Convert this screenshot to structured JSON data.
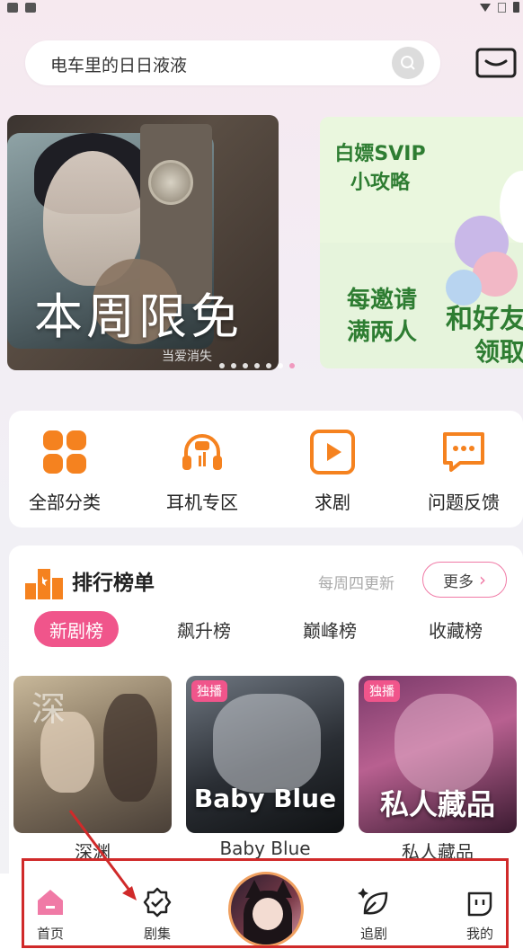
{
  "search": {
    "query": "电车里的日日液液"
  },
  "banners": [
    {
      "title": "本周限免",
      "subtitle": "当爱消失"
    },
    {
      "lines": [
        "白嫖SVIP",
        "小攻略"
      ],
      "lines2": [
        "每邀请",
        "满两人"
      ],
      "side1": "和好友",
      "side2": "领取"
    }
  ],
  "categories": [
    {
      "label": "全部分类",
      "icon": "grid-icon"
    },
    {
      "label": "耳机专区",
      "icon": "headphones-icon"
    },
    {
      "label": "求剧",
      "icon": "play-icon"
    },
    {
      "label": "问题反馈",
      "icon": "feedback-icon"
    }
  ],
  "ranking": {
    "title": "排行榜单",
    "update_note": "每周四更新",
    "more_label": "更多",
    "tabs": [
      "新剧榜",
      "飙升榜",
      "巅峰榜",
      "收藏榜"
    ],
    "active_tab": 0,
    "items": [
      {
        "title": "深渊",
        "badge": "",
        "cover_text": ""
      },
      {
        "title": "Baby Blue",
        "badge": "独播",
        "cover_text": "Baby Blue"
      },
      {
        "title": "私人藏品",
        "badge": "独播",
        "cover_text": "私人藏品"
      }
    ]
  },
  "bottom_nav": [
    {
      "label": "首页",
      "icon": "home-icon",
      "active": true
    },
    {
      "label": "剧集",
      "icon": "badge-check-icon",
      "active": false
    },
    {
      "label": "",
      "icon": "avatar-center",
      "active": false
    },
    {
      "label": "追剧",
      "icon": "leaf-icon",
      "active": false
    },
    {
      "label": "我的",
      "icon": "profile-icon",
      "active": false
    }
  ],
  "colors": {
    "accent": "#f0558b",
    "orange": "#f5821f",
    "annotation": "#d02a2a"
  }
}
